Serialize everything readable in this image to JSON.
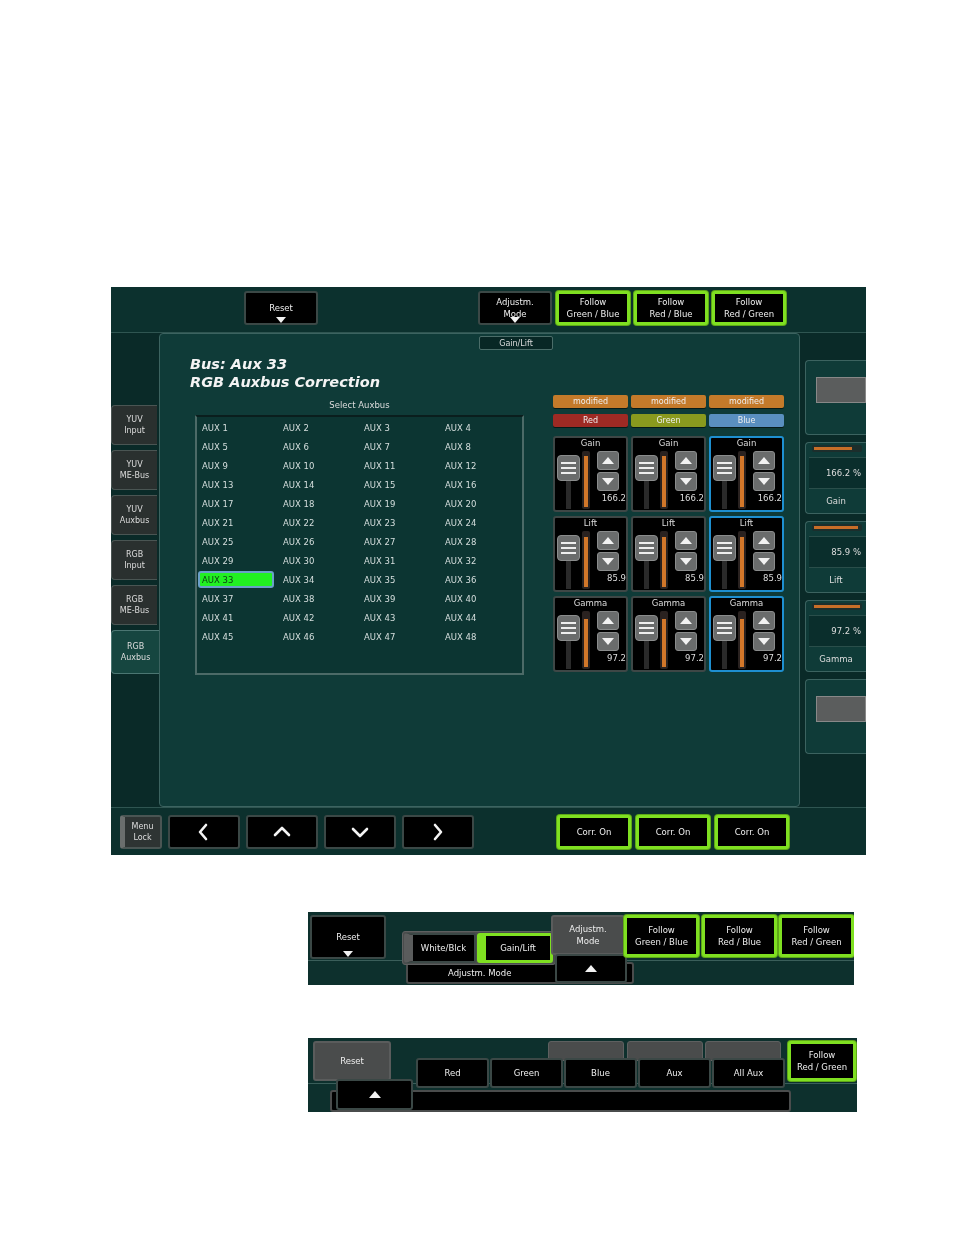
{
  "main_screen": {
    "top_bar": [
      {
        "kind": "menu",
        "lines": [
          "Reset"
        ],
        "on": false
      },
      {
        "kind": "menu",
        "lines": [
          "Adjustm.",
          "Mode"
        ],
        "on": false
      },
      {
        "kind": "toggle",
        "lines": [
          "Follow",
          "Green / Blue"
        ],
        "on": true
      },
      {
        "kind": "toggle",
        "lines": [
          "Follow",
          "Red / Blue"
        ],
        "on": true
      },
      {
        "kind": "toggle",
        "lines": [
          "Follow",
          "Red / Green"
        ],
        "on": true
      }
    ],
    "mode_tab": "Gain/Lift",
    "side_tabs": [
      {
        "lines": [
          "YUV",
          "Input"
        ],
        "selected": false
      },
      {
        "lines": [
          "YUV",
          "ME-Bus"
        ],
        "selected": false
      },
      {
        "lines": [
          "YUV",
          "Auxbus"
        ],
        "selected": false
      },
      {
        "lines": [
          "RGB",
          "Input"
        ],
        "selected": false
      },
      {
        "lines": [
          "RGB",
          "ME-Bus"
        ],
        "selected": false
      },
      {
        "lines": [
          "RGB",
          "Auxbus"
        ],
        "selected": true
      }
    ],
    "title_lines": [
      "Bus: Aux 33",
      "RGB Auxbus Correction"
    ],
    "auxbus": {
      "label": "Select Auxbus",
      "items": [
        {
          "label": "AUX 1",
          "selected": false
        },
        {
          "label": "AUX 2",
          "selected": false
        },
        {
          "label": "AUX 3",
          "selected": false
        },
        {
          "label": "AUX 4",
          "selected": false
        },
        {
          "label": "AUX 5",
          "selected": false
        },
        {
          "label": "AUX 6",
          "selected": false
        },
        {
          "label": "AUX 7",
          "selected": false
        },
        {
          "label": "AUX 8",
          "selected": false
        },
        {
          "label": "AUX 9",
          "selected": false
        },
        {
          "label": "AUX 10",
          "selected": false
        },
        {
          "label": "AUX 11",
          "selected": false
        },
        {
          "label": "AUX 12",
          "selected": false
        },
        {
          "label": "AUX 13",
          "selected": false
        },
        {
          "label": "AUX 14",
          "selected": false
        },
        {
          "label": "AUX 15",
          "selected": false
        },
        {
          "label": "AUX 16",
          "selected": false
        },
        {
          "label": "AUX 17",
          "selected": false
        },
        {
          "label": "AUX 18",
          "selected": false
        },
        {
          "label": "AUX 19",
          "selected": false
        },
        {
          "label": "AUX 20",
          "selected": false
        },
        {
          "label": "AUX 21",
          "selected": false
        },
        {
          "label": "AUX 22",
          "selected": false
        },
        {
          "label": "AUX 23",
          "selected": false
        },
        {
          "label": "AUX 24",
          "selected": false
        },
        {
          "label": "AUX 25",
          "selected": false
        },
        {
          "label": "AUX 26",
          "selected": false
        },
        {
          "label": "AUX 27",
          "selected": false
        },
        {
          "label": "AUX 28",
          "selected": false
        },
        {
          "label": "AUX 29",
          "selected": false
        },
        {
          "label": "AUX 30",
          "selected": false
        },
        {
          "label": "AUX 31",
          "selected": false
        },
        {
          "label": "AUX 32",
          "selected": false
        },
        {
          "label": "AUX 33",
          "selected": true
        },
        {
          "label": "AUX 34",
          "selected": false
        },
        {
          "label": "AUX 35",
          "selected": false
        },
        {
          "label": "AUX 36",
          "selected": false
        },
        {
          "label": "AUX 37",
          "selected": false
        },
        {
          "label": "AUX 38",
          "selected": false
        },
        {
          "label": "AUX 39",
          "selected": false
        },
        {
          "label": "AUX 40",
          "selected": false
        },
        {
          "label": "AUX 41",
          "selected": false
        },
        {
          "label": "AUX 42",
          "selected": false
        },
        {
          "label": "AUX 43",
          "selected": false
        },
        {
          "label": "AUX 44",
          "selected": false
        },
        {
          "label": "AUX 45",
          "selected": false
        },
        {
          "label": "AUX 46",
          "selected": false
        },
        {
          "label": "AUX 47",
          "selected": false
        },
        {
          "label": "AUX 48",
          "selected": false
        }
      ]
    },
    "channels": [
      {
        "status": "modified",
        "name": "Red",
        "color": "#9e2a24",
        "selected": false,
        "controls": [
          {
            "label": "Gain",
            "value": "166.2",
            "level": 0.95
          },
          {
            "label": "Lift",
            "value": "85.9",
            "level": 0.92
          },
          {
            "label": "Gamma",
            "value": "97.2",
            "level": 0.88
          }
        ]
      },
      {
        "status": "modified",
        "name": "Green",
        "color": "#8a9a1e",
        "selected": false,
        "controls": [
          {
            "label": "Gain",
            "value": "166.2",
            "level": 0.95
          },
          {
            "label": "Lift",
            "value": "85.9",
            "level": 0.92
          },
          {
            "label": "Gamma",
            "value": "97.2",
            "level": 0.88
          }
        ]
      },
      {
        "status": "modified",
        "name": "Blue",
        "color": "#5a8fc0",
        "selected": true,
        "controls": [
          {
            "label": "Gain",
            "value": "166.2",
            "level": 0.95
          },
          {
            "label": "Lift",
            "value": "85.9",
            "level": 0.92
          },
          {
            "label": "Gamma",
            "value": "97.2",
            "level": 0.88
          }
        ]
      }
    ],
    "readouts": [
      {
        "value": "166.2 %",
        "label": "Gain",
        "level": 0.82
      },
      {
        "value": "85.9 %",
        "label": "Lift",
        "level": 0.95
      },
      {
        "value": "97.2 %",
        "label": "Gamma",
        "level": 1
      }
    ],
    "bottom_bar": {
      "menu_lock": [
        "Menu",
        "Lock"
      ],
      "nav": [
        {
          "kind": "left"
        },
        {
          "kind": "up"
        },
        {
          "kind": "down"
        },
        {
          "kind": "right"
        }
      ],
      "corr_buttons": [
        {
          "label": "Corr. On",
          "on": true
        },
        {
          "label": "Corr. On",
          "on": true
        },
        {
          "label": "Corr. On",
          "on": true
        }
      ]
    }
  },
  "adjust_popup": {
    "reset": "Reset",
    "options": [
      {
        "label": "White/Blck",
        "selected": false
      },
      {
        "label": "Gain/Lift",
        "selected": true
      }
    ],
    "adjust_mode": [
      "Adjustm.",
      "Mode"
    ],
    "mode_label": "Adjustm. Mode",
    "follow": [
      {
        "lines": [
          "Follow",
          "Green / Blue"
        ],
        "on": true
      },
      {
        "lines": [
          "Follow",
          "Red / Blue"
        ],
        "on": true
      },
      {
        "lines": [
          "Follow",
          "Red / Green"
        ],
        "on": true
      }
    ]
  },
  "follow_popup": {
    "reset": "Reset",
    "options": [
      {
        "label": "Red"
      },
      {
        "label": "Green"
      },
      {
        "label": "Blue"
      },
      {
        "label": "Aux"
      },
      {
        "label": "All Aux"
      }
    ],
    "follow": {
      "lines": [
        "Follow",
        "Red / Green"
      ],
      "on": true
    }
  }
}
